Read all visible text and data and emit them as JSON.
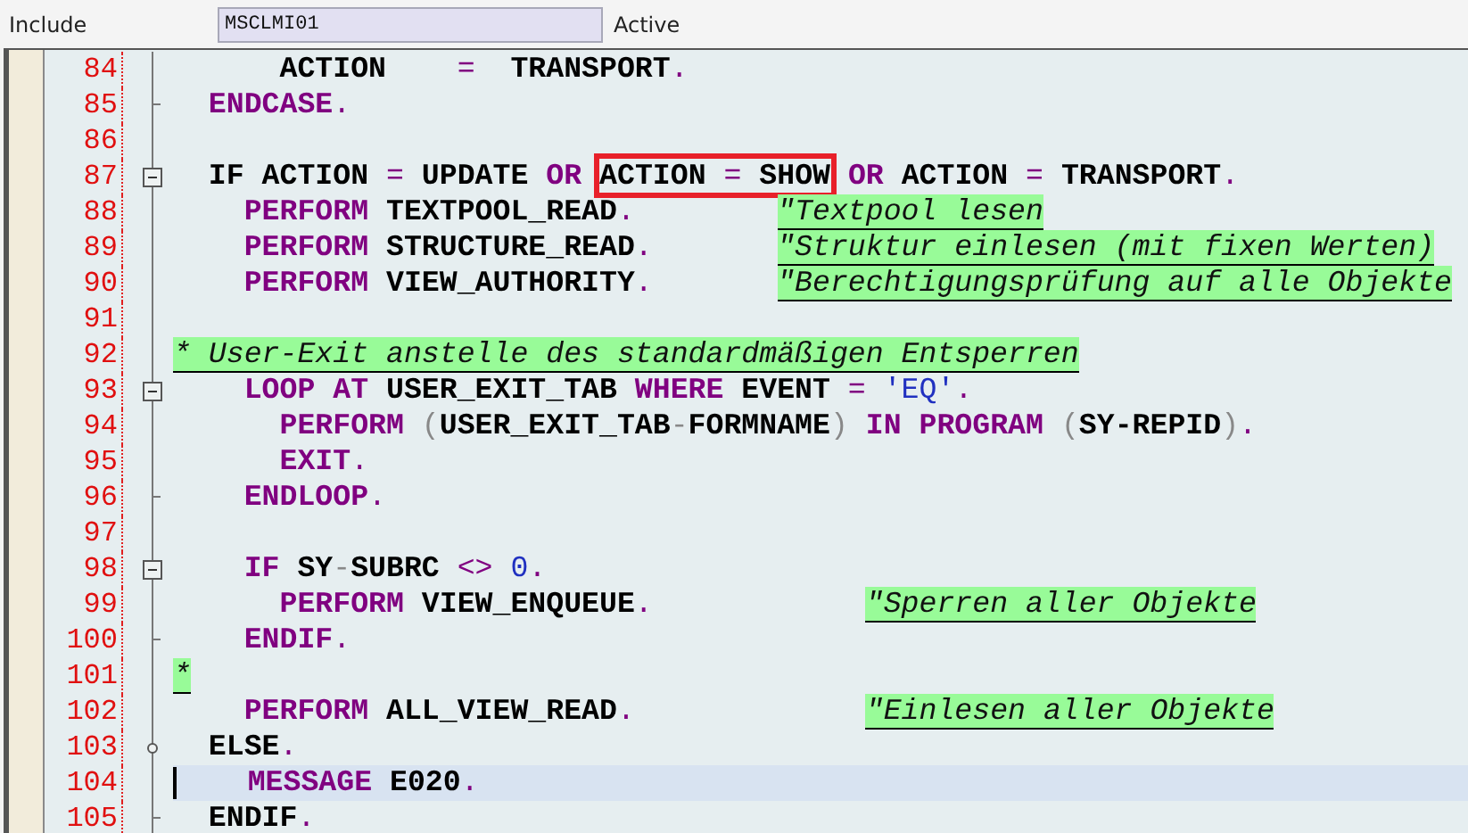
{
  "header": {
    "label": "Include",
    "field_value": "MSCLMI01",
    "status": "Active"
  },
  "lines": [
    {
      "number": "84",
      "kind": "line",
      "current": false,
      "tokens": [
        {
          "kind": "ident",
          "text": "      ACTION"
        },
        {
          "kind": "op",
          "text": "    ="
        },
        {
          "kind": "ident",
          "text": "  TRANSPORT"
        },
        {
          "kind": "op",
          "text": "."
        }
      ]
    },
    {
      "number": "85",
      "kind": "end",
      "current": false,
      "tokens": [
        {
          "kind": "keyword",
          "text": "  ENDCASE"
        },
        {
          "kind": "op",
          "text": "."
        }
      ]
    },
    {
      "number": "86",
      "kind": "line",
      "current": false
    },
    {
      "number": "87",
      "kind": "open",
      "current": false,
      "tokens": [
        {
          "kind": "ident",
          "text": "  IF ACTION"
        },
        {
          "kind": "op",
          "text": " ="
        },
        {
          "kind": "ident",
          "text": " UPDATE"
        },
        {
          "kind": "keyword",
          "text": " OR "
        },
        {
          "kind": "boxed",
          "tokens": [
            {
              "kind": "ident",
              "text": "ACTION"
            },
            {
              "kind": "op",
              "text": " ="
            },
            {
              "kind": "ident",
              "text": " SHOW"
            }
          ]
        },
        {
          "kind": "keyword",
          "text": " OR"
        },
        {
          "kind": "ident",
          "text": " ACTION"
        },
        {
          "kind": "op",
          "text": " ="
        },
        {
          "kind": "ident",
          "text": " TRANSPORT"
        },
        {
          "kind": "op",
          "text": "."
        }
      ]
    },
    {
      "number": "88",
      "kind": "line",
      "current": false,
      "tokens": [
        {
          "kind": "keyword",
          "text": "    PERFORM"
        },
        {
          "kind": "ident",
          "text": " TEXTPOOL_READ"
        },
        {
          "kind": "op",
          "text": ".        "
        },
        {
          "kind": "comment",
          "text": "\"Textpool lesen"
        }
      ]
    },
    {
      "number": "89",
      "kind": "line",
      "current": false,
      "tokens": [
        {
          "kind": "keyword",
          "text": "    PERFORM"
        },
        {
          "kind": "ident",
          "text": " STRUCTURE_READ"
        },
        {
          "kind": "op",
          "text": ".       "
        },
        {
          "kind": "comment",
          "text": "\"Struktur einlesen (mit fixen Werten)"
        }
      ]
    },
    {
      "number": "90",
      "kind": "line",
      "current": false,
      "tokens": [
        {
          "kind": "keyword",
          "text": "    PERFORM"
        },
        {
          "kind": "ident",
          "text": " VIEW_AUTHORITY"
        },
        {
          "kind": "op",
          "text": ".       "
        },
        {
          "kind": "comment",
          "text": "\"Berechtigungsprüfung auf alle Objekte"
        }
      ]
    },
    {
      "number": "91",
      "kind": "line",
      "current": false
    },
    {
      "number": "92",
      "kind": "line",
      "current": false,
      "tokens": [
        {
          "kind": "comment",
          "text": "* User-Exit anstelle des standardmäßigen Entsperren"
        }
      ]
    },
    {
      "number": "93",
      "kind": "open",
      "current": false,
      "tokens": [
        {
          "kind": "keyword",
          "text": "    LOOP AT"
        },
        {
          "kind": "ident",
          "text": " USER_EXIT_TAB"
        },
        {
          "kind": "keyword",
          "text": " WHERE"
        },
        {
          "kind": "ident",
          "text": " EVENT"
        },
        {
          "kind": "op",
          "text": " ="
        },
        {
          "kind": "string",
          "text": " 'EQ'"
        },
        {
          "kind": "op",
          "text": "."
        }
      ]
    },
    {
      "number": "94",
      "kind": "line",
      "current": false,
      "tokens": [
        {
          "kind": "keyword",
          "text": "      PERFORM"
        },
        {
          "kind": "paren",
          "text": " ("
        },
        {
          "kind": "ident",
          "text": "USER_EXIT_TAB"
        },
        {
          "kind": "paren",
          "text": "-"
        },
        {
          "kind": "ident",
          "text": "FORMNAME"
        },
        {
          "kind": "paren",
          "text": ")"
        },
        {
          "kind": "keyword",
          "text": " IN PROGRAM"
        },
        {
          "kind": "paren",
          "text": " ("
        },
        {
          "kind": "ident",
          "text": "SY-REPID"
        },
        {
          "kind": "paren",
          "text": ")"
        },
        {
          "kind": "op",
          "text": "."
        }
      ]
    },
    {
      "number": "95",
      "kind": "line",
      "current": false,
      "tokens": [
        {
          "kind": "keyword",
          "text": "      EXIT"
        },
        {
          "kind": "op",
          "text": "."
        }
      ]
    },
    {
      "number": "96",
      "kind": "end",
      "current": false,
      "tokens": [
        {
          "kind": "keyword",
          "text": "    ENDLOOP"
        },
        {
          "kind": "op",
          "text": "."
        }
      ]
    },
    {
      "number": "97",
      "kind": "line",
      "current": false
    },
    {
      "number": "98",
      "kind": "open",
      "current": false,
      "tokens": [
        {
          "kind": "keyword",
          "text": "    IF"
        },
        {
          "kind": "ident",
          "text": " SY"
        },
        {
          "kind": "paren",
          "text": "-"
        },
        {
          "kind": "ident",
          "text": "SUBRC"
        },
        {
          "kind": "op",
          "text": " <>"
        },
        {
          "kind": "number",
          "text": " 0"
        },
        {
          "kind": "op",
          "text": "."
        }
      ]
    },
    {
      "number": "99",
      "kind": "line",
      "current": false,
      "tokens": [
        {
          "kind": "keyword",
          "text": "      PERFORM"
        },
        {
          "kind": "ident",
          "text": " VIEW_ENQUEUE"
        },
        {
          "kind": "op",
          "text": ".            "
        },
        {
          "kind": "comment",
          "text": "\"Sperren aller Objekte"
        }
      ]
    },
    {
      "number": "100",
      "kind": "end",
      "current": false,
      "tokens": [
        {
          "kind": "keyword",
          "text": "    ENDIF"
        },
        {
          "kind": "op",
          "text": "."
        }
      ]
    },
    {
      "number": "101",
      "kind": "line",
      "current": false,
      "tokens": [
        {
          "kind": "comment",
          "text": "*"
        }
      ]
    },
    {
      "number": "102",
      "kind": "line",
      "current": false,
      "tokens": [
        {
          "kind": "keyword",
          "text": "    PERFORM"
        },
        {
          "kind": "ident",
          "text": " ALL_VIEW_READ"
        },
        {
          "kind": "op",
          "text": ".             "
        },
        {
          "kind": "comment",
          "text": "\"Einlesen aller Objekte"
        }
      ]
    },
    {
      "number": "103",
      "kind": "dot",
      "current": false,
      "tokens": [
        {
          "kind": "ident",
          "text": "  ELSE"
        },
        {
          "kind": "op",
          "text": "."
        }
      ]
    },
    {
      "number": "104",
      "kind": "line",
      "current": true,
      "tokens": [
        {
          "kind": "keyword",
          "text": "    MESSAGE"
        },
        {
          "kind": "ident",
          "text": " E020"
        },
        {
          "kind": "op",
          "text": "."
        }
      ]
    },
    {
      "number": "105",
      "kind": "end",
      "current": false,
      "tokens": [
        {
          "kind": "ident",
          "text": "  ENDIF"
        },
        {
          "kind": "op",
          "text": "."
        }
      ]
    }
  ]
}
